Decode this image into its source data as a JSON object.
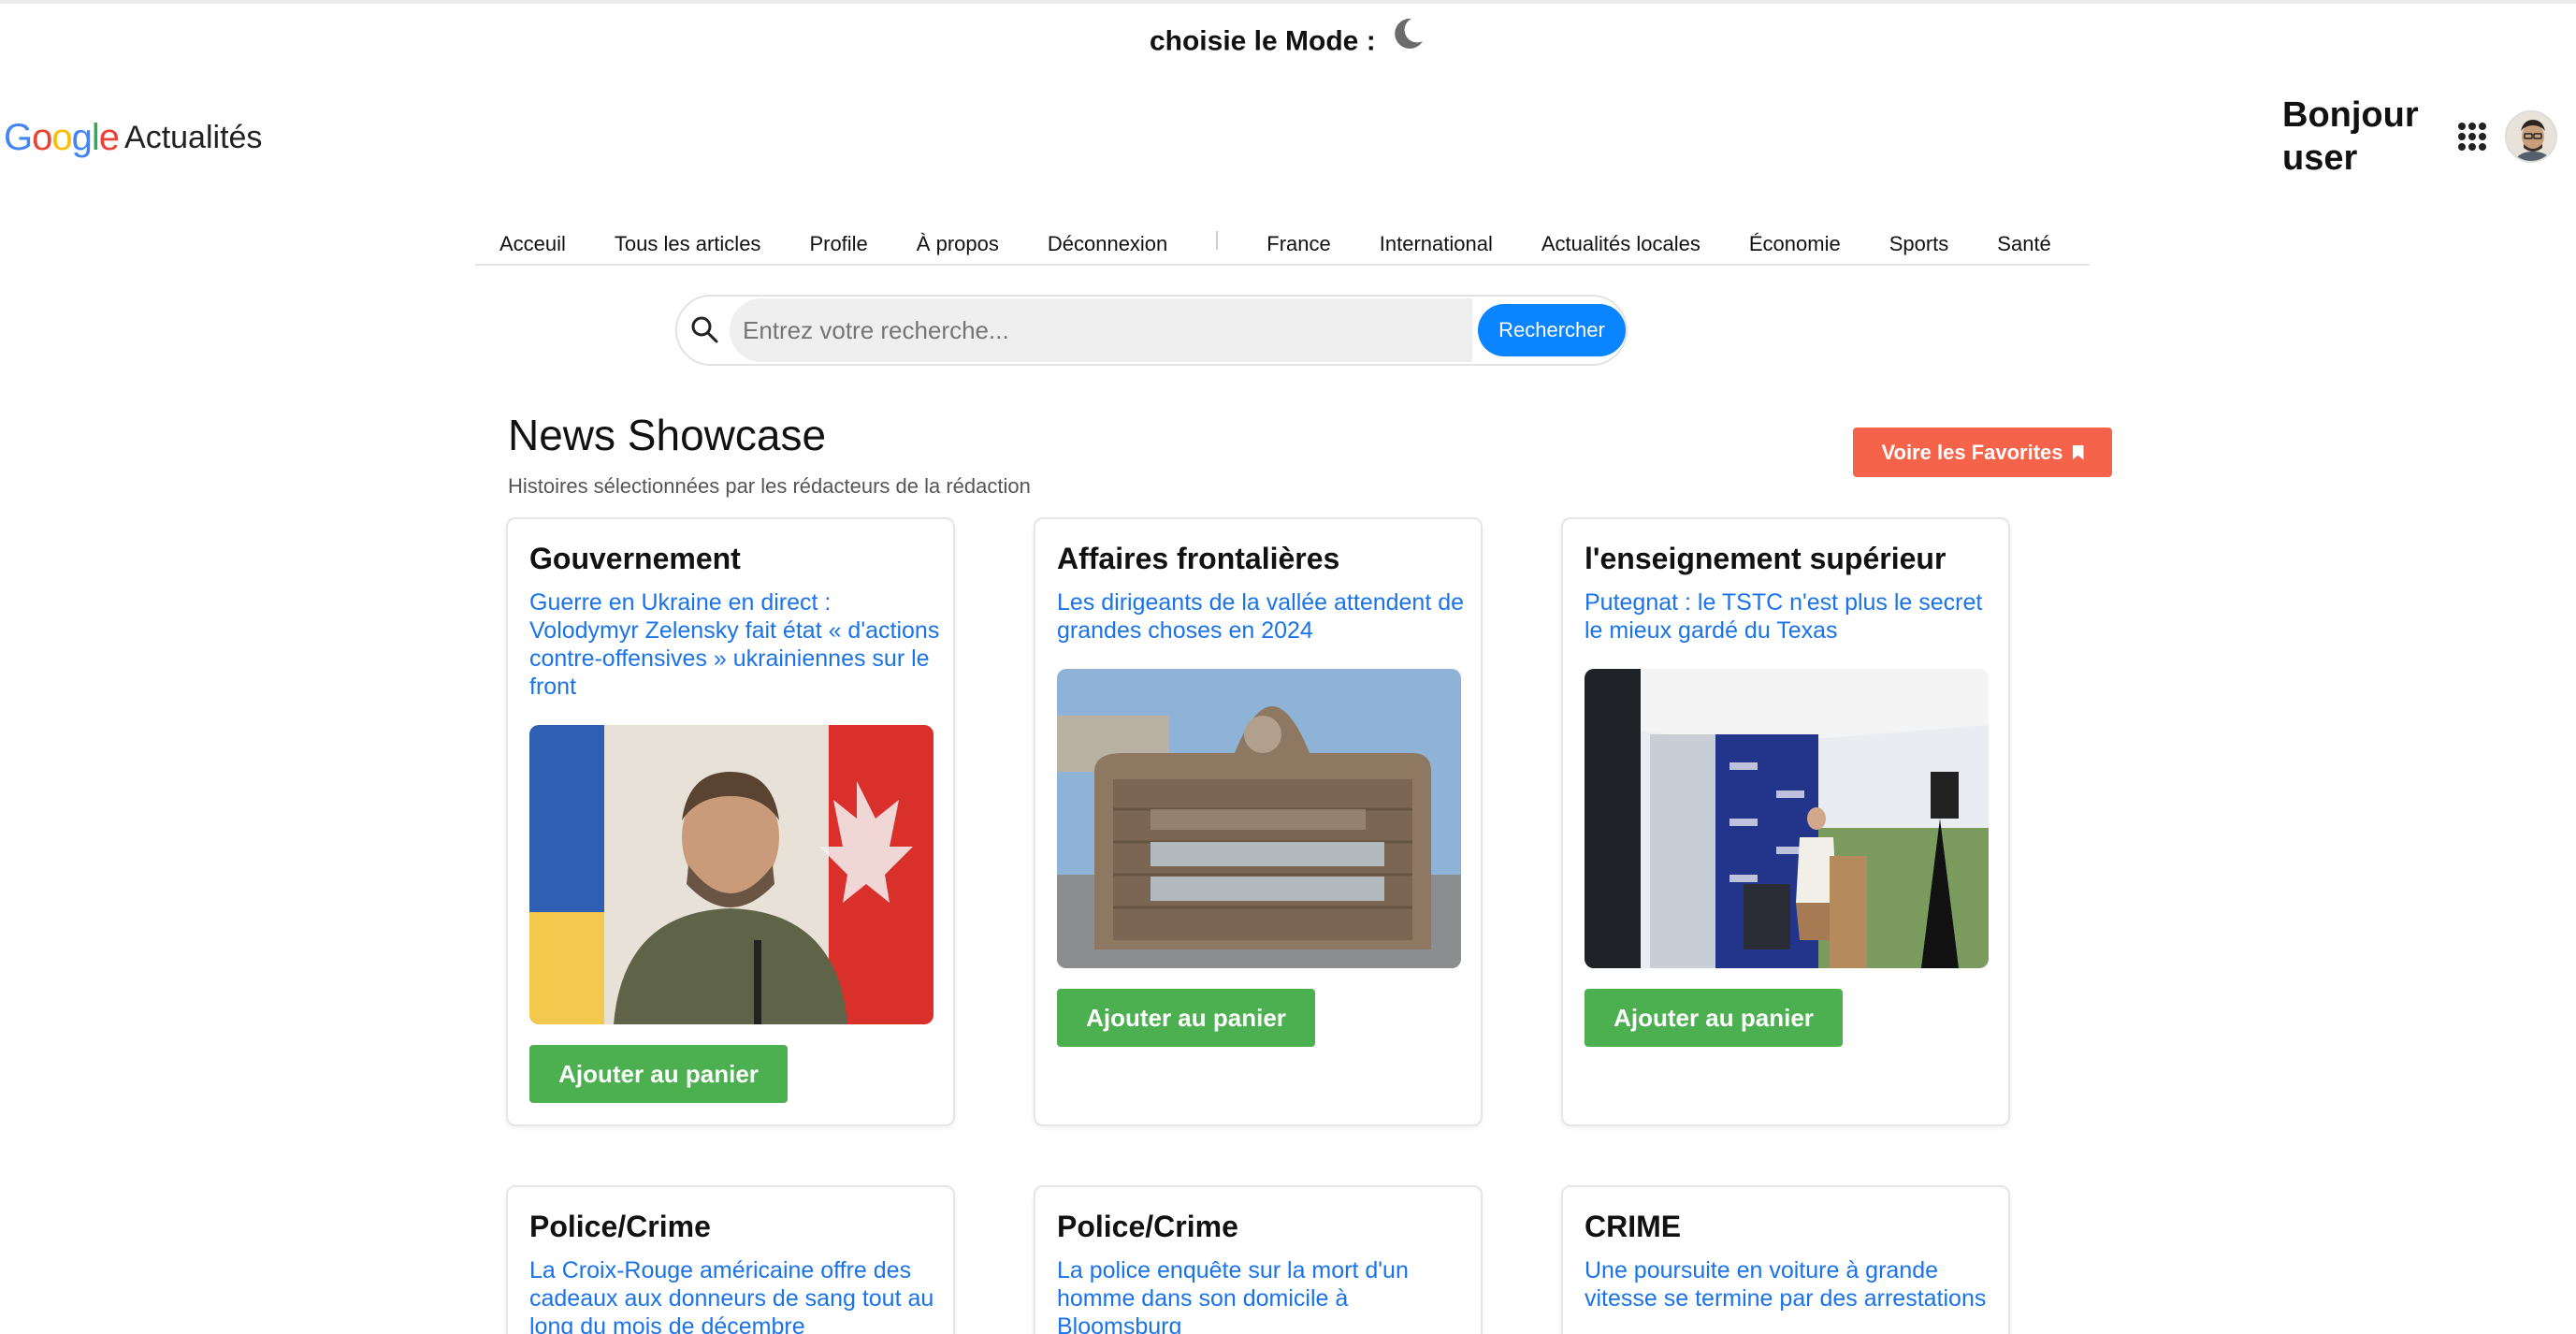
{
  "mode": {
    "label": "choisie le Mode :",
    "icon": "moon-icon"
  },
  "logo": {
    "brand": "Google",
    "app": "Actualités"
  },
  "user": {
    "greeting": "Bonjour user"
  },
  "nav": {
    "items": [
      "Acceuil",
      "Tous les articles",
      "Profile",
      "À propos",
      "Déconnexion"
    ],
    "topics": [
      "France",
      "International",
      "Actualités locales",
      "Économie",
      "Sports",
      "Santé"
    ]
  },
  "search": {
    "placeholder": "Entrez votre recherche...",
    "button": "Rechercher"
  },
  "showcase": {
    "title": "News Showcase",
    "subtitle": "Histoires sélectionnées par les rédacteurs de la rédaction",
    "favorites_button": "Voire les Favorites"
  },
  "cards": [
    {
      "category": "Gouvernement",
      "headline": "Guerre en Ukraine en direct : Volodymyr Zelensky fait état « d'actions contre-offensives » ukrainiennes sur le front",
      "button": "Ajouter au panier"
    },
    {
      "category": "Affaires frontalières",
      "headline": "Les dirigeants de la vallée attendent de grandes choses en 2024",
      "button": "Ajouter au panier"
    },
    {
      "category": "l'enseignement supérieur",
      "headline": "Putegnat : le TSTC n'est plus le secret le mieux gardé du Texas",
      "button": "Ajouter au panier"
    },
    {
      "category": "Police/Crime",
      "headline": "La Croix-Rouge américaine offre des cadeaux aux donneurs de sang tout au long du mois de décembre"
    },
    {
      "category": "Police/Crime",
      "headline": "La police enquête sur la mort d'un homme dans son domicile à Bloomsburg"
    },
    {
      "category": "CRIME",
      "headline": "Une poursuite en voiture à grande vitesse se termine par des arrestations"
    }
  ],
  "colors": {
    "accent_blue": "#0a84ff",
    "link_blue": "#1a73e8",
    "green": "#4caf50",
    "favorites_red": "#f4634a"
  }
}
